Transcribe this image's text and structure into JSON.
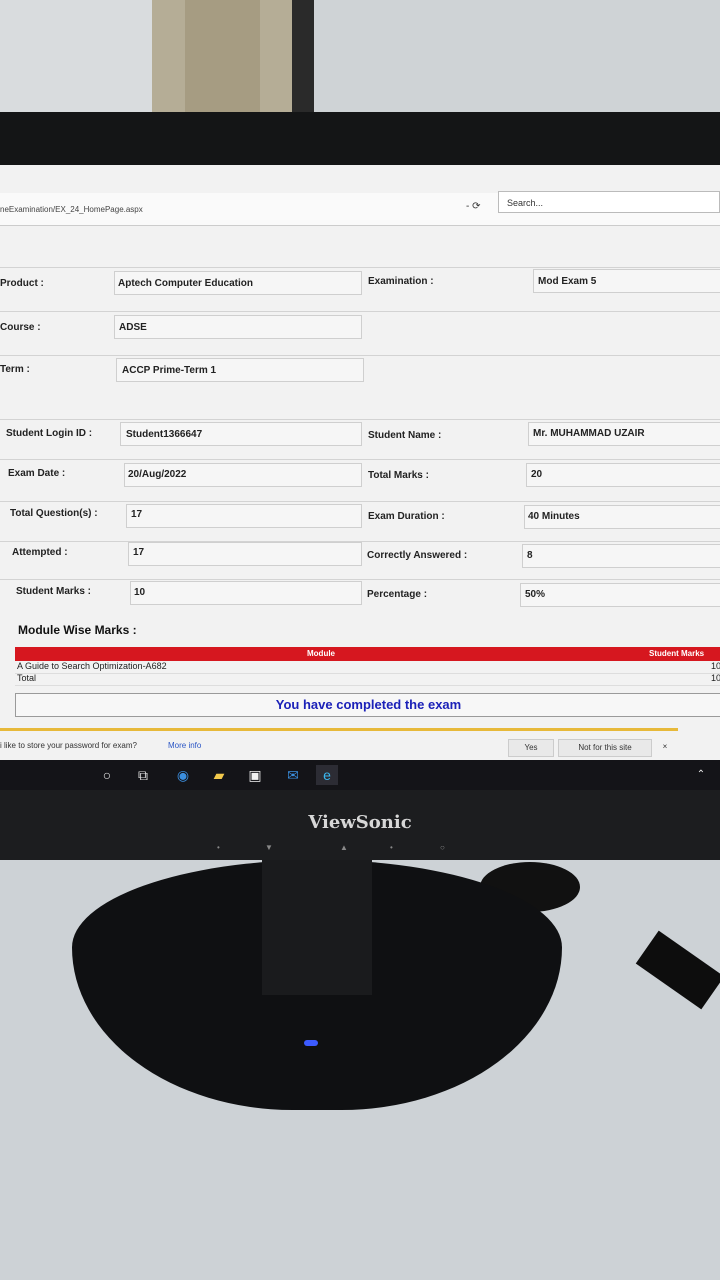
{
  "browser": {
    "url": "neExamination/EX_24_HomePage.aspx",
    "nav_controls": "- ⟳",
    "search_placeholder": "Search..."
  },
  "exam_info": {
    "product_label": "Product :",
    "product_value": "Aptech Computer Education",
    "examination_label": "Examination :",
    "examination_value": "Mod Exam 5",
    "course_label": "Course :",
    "course_value": "ADSE",
    "term_label": "Term :",
    "term_value": "ACCP Prime-Term 1"
  },
  "results": {
    "login_label": "Student Login ID :",
    "login_value": "Student1366647",
    "name_label": "Student Name :",
    "name_value": "Mr. MUHAMMAD UZAIR",
    "date_label": "Exam Date :",
    "date_value": "20/Aug/2022",
    "total_marks_label": "Total Marks :",
    "total_marks_value": "20",
    "total_q_label": "Total Question(s) :",
    "total_q_value": "17",
    "duration_label": "Exam Duration :",
    "duration_value": "40 Minutes",
    "attempted_label": "Attempted :",
    "attempted_value": "17",
    "correct_label": "Correctly Answered :",
    "correct_value": "8",
    "student_marks_label": "Student Marks :",
    "student_marks_value": "10",
    "percentage_label": "Percentage :",
    "percentage_value": "50%"
  },
  "module_marks": {
    "title": "Module Wise Marks :",
    "col_module": "Module",
    "col_marks": "Student Marks",
    "rows": [
      {
        "module": "A Guide to Search Optimization-A682",
        "marks": "10"
      },
      {
        "module": "Total",
        "marks": "10"
      }
    ]
  },
  "completion_message": "You have completed the exam",
  "password_bar": {
    "text": "i like to store your password for exam?",
    "more_info": "More info",
    "yes": "Yes",
    "not_for_site": "Not for this site",
    "close": "×"
  },
  "monitor": {
    "brand": "ViewSonic"
  },
  "colors": {
    "header_red": "#d6171f",
    "completion_blue": "#1b21b8",
    "password_bar_accent": "#e7b93a"
  }
}
